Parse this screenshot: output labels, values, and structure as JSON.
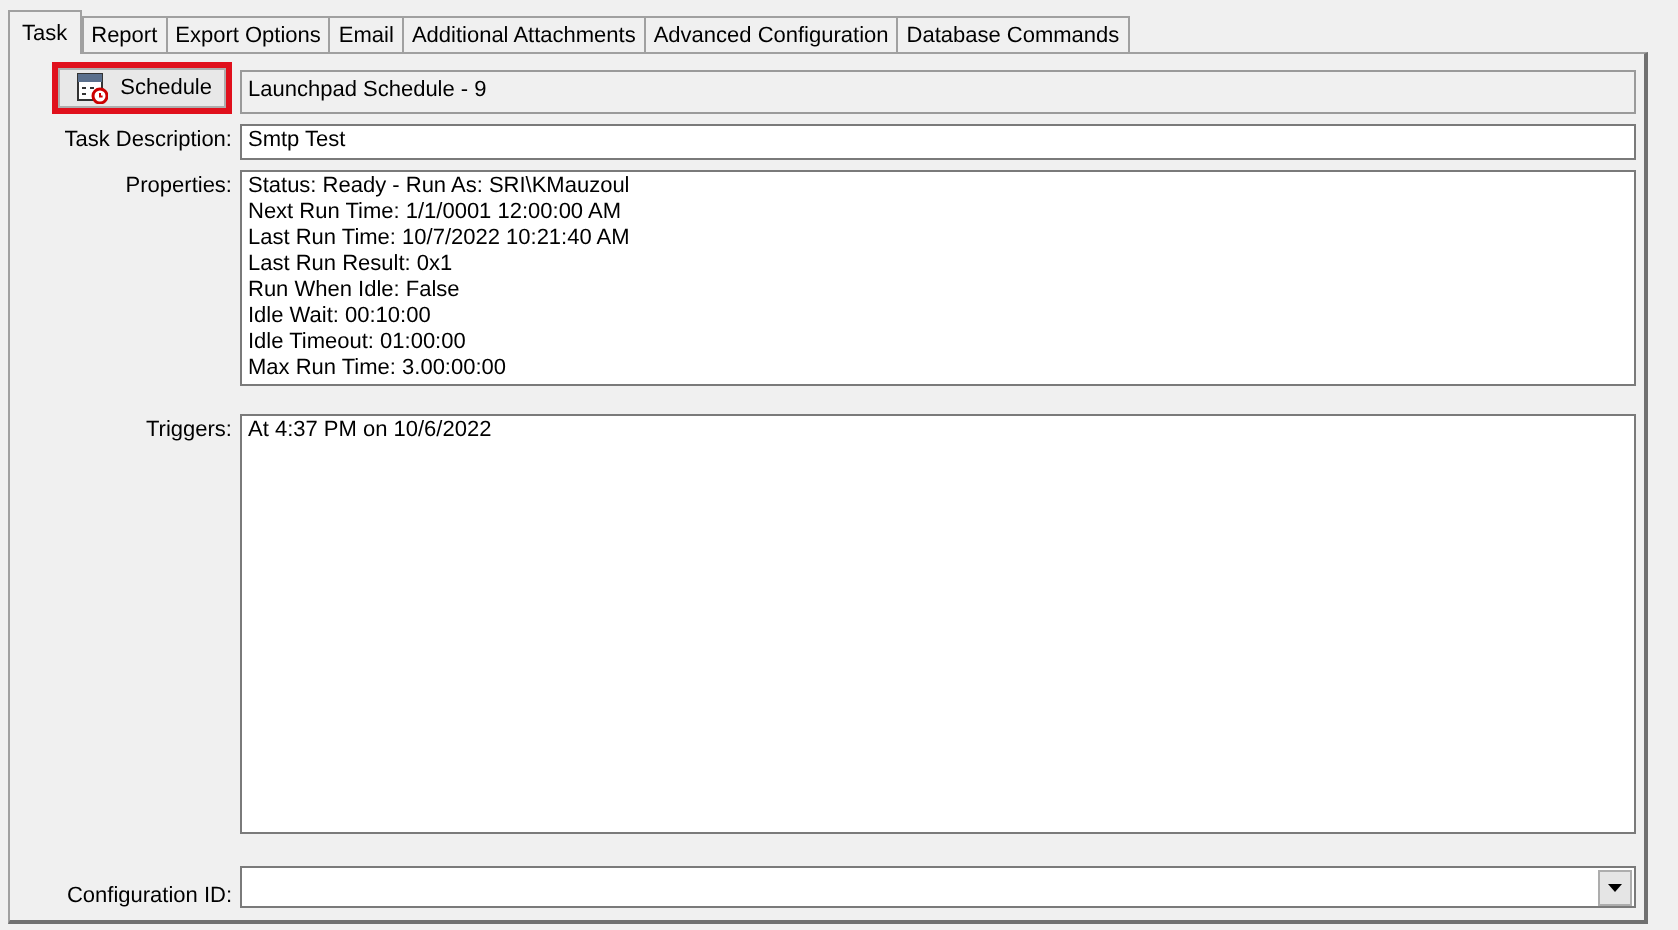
{
  "tabs": [
    {
      "label": "Task",
      "selected": true
    },
    {
      "label": "Report",
      "selected": false
    },
    {
      "label": "Export Options",
      "selected": false
    },
    {
      "label": "Email",
      "selected": false
    },
    {
      "label": "Additional Attachments",
      "selected": false
    },
    {
      "label": "Advanced Configuration",
      "selected": false
    },
    {
      "label": "Database Commands",
      "selected": false
    }
  ],
  "schedule": {
    "button": "Schedule",
    "value": "Launchpad Schedule - 9",
    "highlighted": true
  },
  "task_description": {
    "label": "Task Description:",
    "value": "Smtp Test"
  },
  "properties": {
    "label": "Properties:",
    "lines": [
      "Status: Ready - Run As: SRI\\KMauzoul",
      "Next Run Time: 1/1/0001 12:00:00 AM",
      "Last Run Time: 10/7/2022 10:21:40 AM",
      "Last Run Result: 0x1",
      "Run When Idle: False",
      "Idle Wait: 00:10:00",
      "Idle Timeout: 01:00:00",
      "Max Run Time: 3.00:00:00"
    ]
  },
  "triggers": {
    "label": "Triggers:",
    "lines": [
      "At 4:37 PM on 10/6/2022"
    ]
  },
  "configuration_id": {
    "label": "Configuration ID:"
  }
}
